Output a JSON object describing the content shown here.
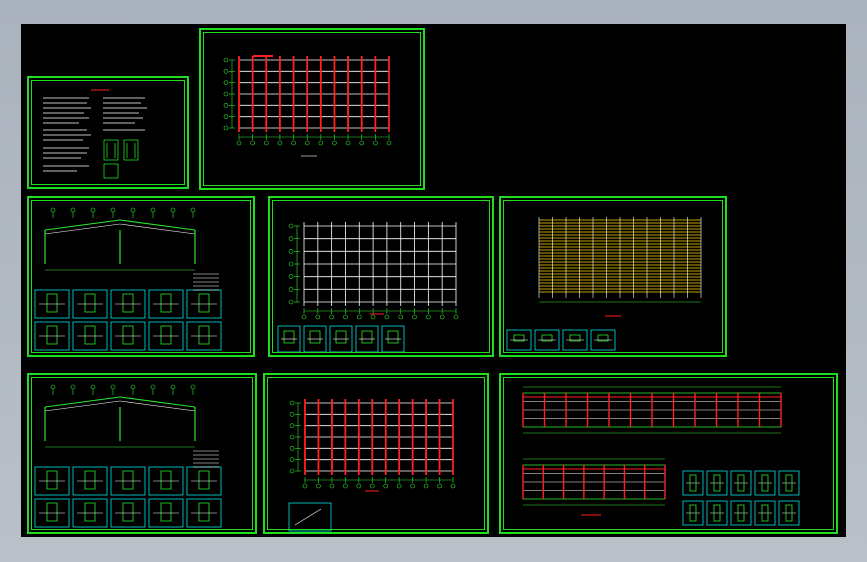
{
  "viewport": {
    "background": "#000000",
    "sheet_color": "#1edc1e",
    "line_colors": {
      "grid": "#ffffff",
      "columns": "#ff2020",
      "dims": "#2ee62e",
      "highlight": "#ffd400",
      "cyan": "#00e5e5"
    }
  },
  "sheets": [
    {
      "id": "sheet-notes",
      "kind": "notes"
    },
    {
      "id": "sheet-roof-plan",
      "kind": "column-grid-red"
    },
    {
      "id": "sheet-frame-1",
      "kind": "frame-details"
    },
    {
      "id": "sheet-column-grid",
      "kind": "column-grid-white"
    },
    {
      "id": "sheet-purlin-plan",
      "kind": "purlin-plan"
    },
    {
      "id": "sheet-frame-2",
      "kind": "frame-details"
    },
    {
      "id": "sheet-bracing-plan",
      "kind": "column-grid-red"
    },
    {
      "id": "sheet-elevations",
      "kind": "elevations"
    }
  ]
}
